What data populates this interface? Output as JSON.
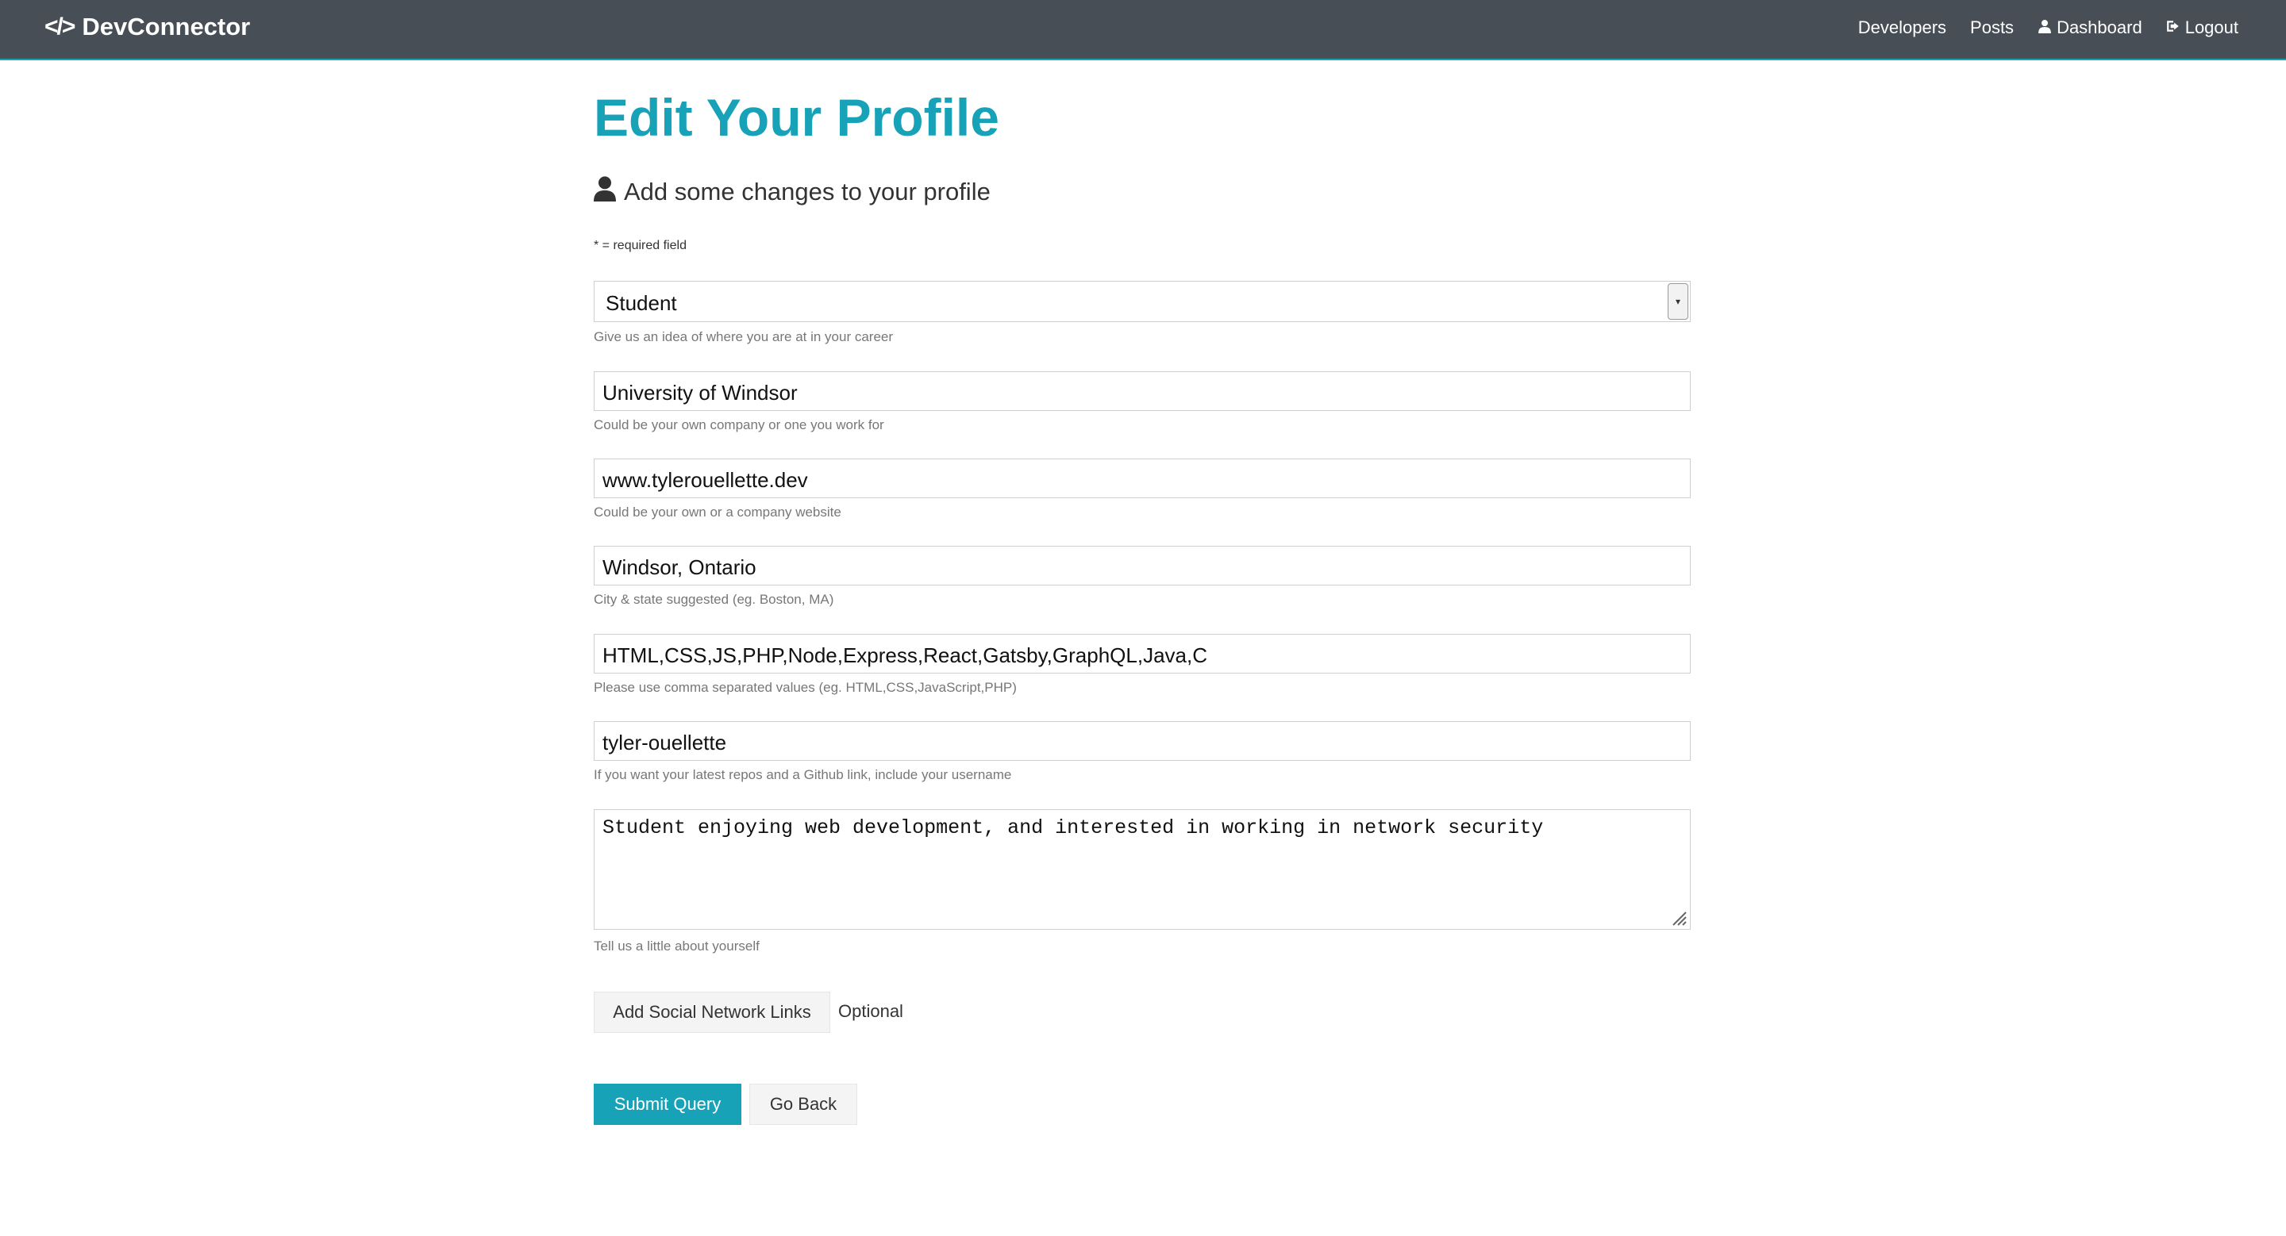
{
  "navbar": {
    "brand_icon": "</>",
    "brand_name": "DevConnector",
    "links": [
      {
        "label": "Developers",
        "icon": ""
      },
      {
        "label": "Posts",
        "icon": ""
      },
      {
        "label": "Dashboard",
        "icon": "user-icon"
      },
      {
        "label": "Logout",
        "icon": "sign-out-icon"
      }
    ]
  },
  "page": {
    "title": "Edit Your Profile",
    "lead": "Add some changes to your profile",
    "required_note": "* = required field"
  },
  "form": {
    "status": {
      "value": "Student",
      "hint": "Give us an idea of where you are at in your career"
    },
    "company": {
      "value": "University of Windsor",
      "hint": "Could be your own company or one you work for"
    },
    "website": {
      "value": "www.tylerouellette.dev",
      "hint": "Could be your own or a company website"
    },
    "location": {
      "value": "Windsor, Ontario",
      "hint": "City & state suggested (eg. Boston, MA)"
    },
    "skills": {
      "value": "HTML,CSS,JS,PHP,Node,Express,React,Gatsby,GraphQL,Java,C",
      "hint": "Please use comma separated values (eg. HTML,CSS,JavaScript,PHP)"
    },
    "github": {
      "value": "tyler-ouellette",
      "hint": "If you want your latest repos and a Github link, include your username"
    },
    "bio": {
      "value": "Student enjoying web development, and interested in working in network security",
      "hint": "Tell us a little about yourself"
    },
    "social_button": "Add Social Network Links",
    "optional_label": "Optional",
    "submit_button": "Submit Query",
    "back_button": "Go Back"
  },
  "colors": {
    "navbar_bg": "#474e55",
    "primary": "#17a2b8",
    "light_button": "#f4f4f4"
  }
}
